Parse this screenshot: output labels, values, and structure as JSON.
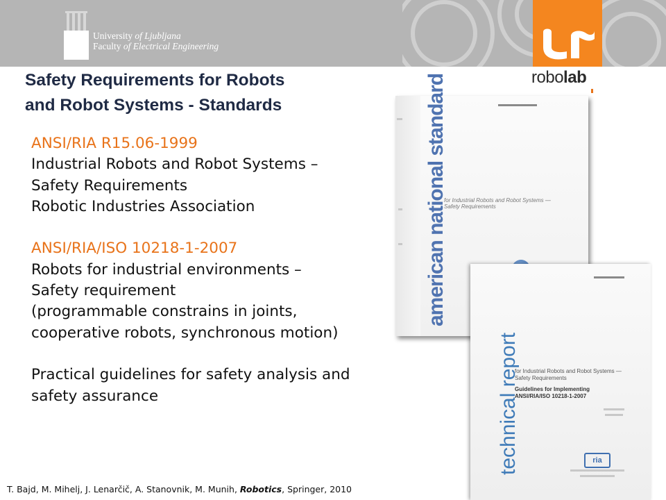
{
  "header": {
    "university_line1_prefix": "University ",
    "university_line1_italic": "of Ljubljana",
    "university_line2_prefix": "Faculty ",
    "university_line2_italic": "of Electrical Engineering",
    "brand_name_regular": "robo",
    "brand_name_bold": "lab",
    "brand_color": "#f4861f",
    "band_color": "#b5b5b5"
  },
  "title": {
    "line1": "Safety Requirements for Robots",
    "line2": "and Robot Systems - Standards"
  },
  "standards": [
    {
      "code": "ANSI/RIA R15.06-1999",
      "lines": [
        "Industrial Robots and Robot Systems –",
        "Safety Requirements",
        "Robotic Industries Association"
      ]
    },
    {
      "code": "ANSI/RIA/ISO 10218-1-2007",
      "lines": [
        "Robots for industrial environments –",
        "Safety requirement",
        "(programmable constrains in joints,",
        "cooperative robots, synchronous motion)"
      ]
    }
  ],
  "guidelines": {
    "lines": [
      "Practical guidelines for safety analysis and",
      "safety assurance"
    ]
  },
  "documents": {
    "doc1_title": "american national standard",
    "doc1_subtitle_1": "for Industrial Robots and Robot Systems —",
    "doc1_subtitle_2": "Safety Requirements",
    "doc2_title": "technical report",
    "doc2_subtitle_1": "for Industrial Robots and Robot Systems —",
    "doc2_subtitle_2": "Safety Requirements",
    "doc2_subtitle_3": "Guidelines for Implementing",
    "doc2_subtitle_4": "ANSI/RIA/ISO 10218-1-2007",
    "doc2_logo": "ria"
  },
  "footer": {
    "authors": "T. Bajd, M. Mihelj, J. Lenarčič, A. Stanovnik, M. Munih, ",
    "book": "Robotics",
    "publisher": ", Springer, 2010"
  },
  "accent_color": "#e8731a",
  "icons": [
    "university-building-icon",
    "lr-logo-icon",
    "globe-icon",
    "ria-logo-icon"
  ]
}
